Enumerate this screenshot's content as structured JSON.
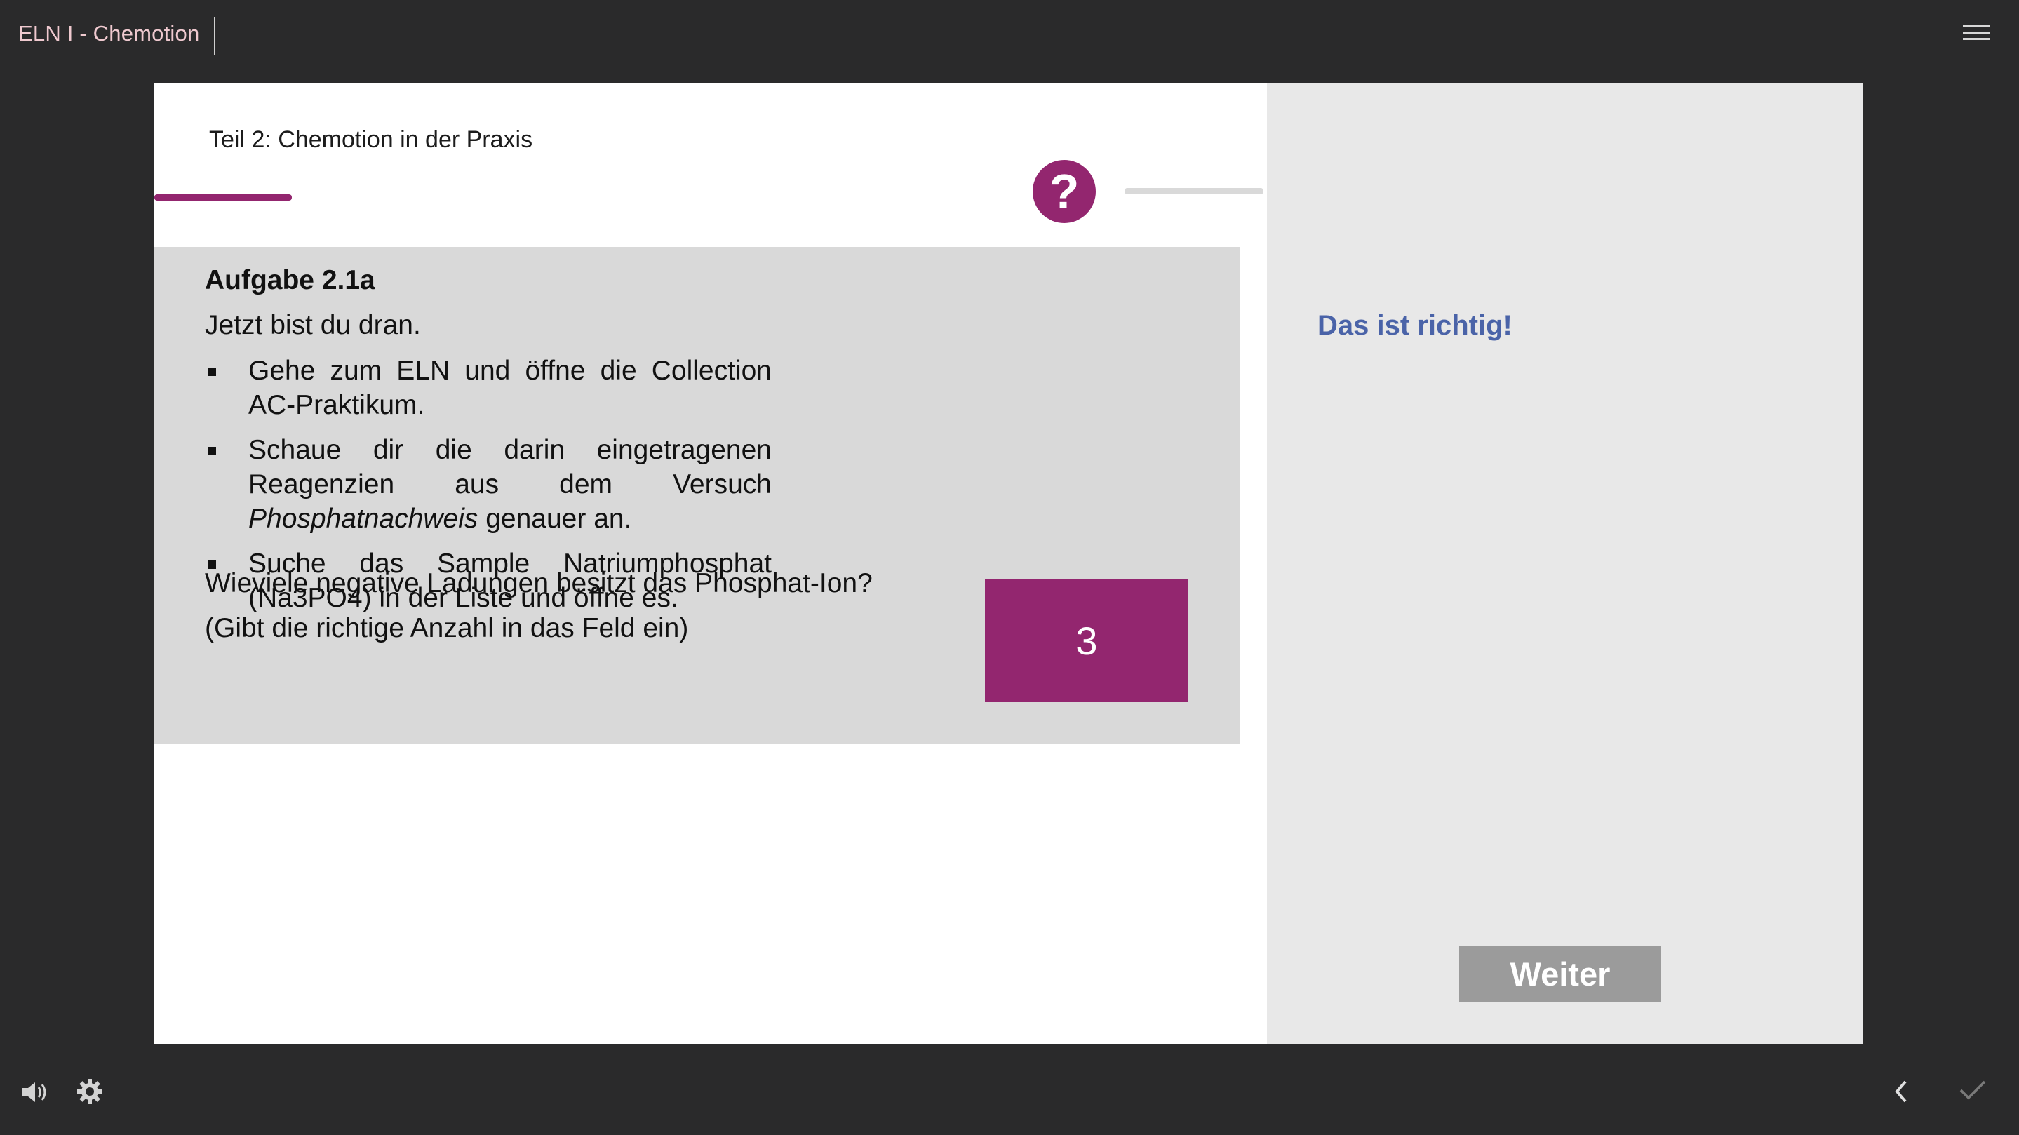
{
  "app": {
    "title": "ELN I - Chemotion"
  },
  "slide": {
    "heading": "Teil 2: Chemotion in der Praxis",
    "help_icon_glyph": "?",
    "task": {
      "title": "Aufgabe 2.1a",
      "intro": "Jetzt bist du dran.",
      "steps": [
        "Gehe zum ELN und öffne die Collection AC-Praktikum.",
        {
          "prefix": "Schaue dir die darin eingetragenen Reagenzien aus dem Versuch ",
          "emphasis": "Phosphatnachweis",
          "suffix": " genauer an."
        },
        "Suche das Sample Natriumphosphat (Na3PO4) in der Liste und öffne es."
      ],
      "question_line1": "Wieviele negative Ladungen besitzt das Phosphat-Ion?",
      "question_line2": "(Gibt die richtige Anzahl in das Feld ein)",
      "answer_value": "3"
    },
    "feedback": {
      "message": "Das ist richtig!",
      "continue_label": "Weiter"
    }
  },
  "colors": {
    "accent": "#93266f",
    "feedback_text": "#4a63a8",
    "background": "#2a2a2b"
  },
  "icons": {
    "menu": "hamburger-menu-icon",
    "audio": "speaker-icon",
    "settings": "gear-icon",
    "previous": "chevron-left-icon",
    "submit": "checkmark-icon",
    "help": "question-mark-icon"
  }
}
